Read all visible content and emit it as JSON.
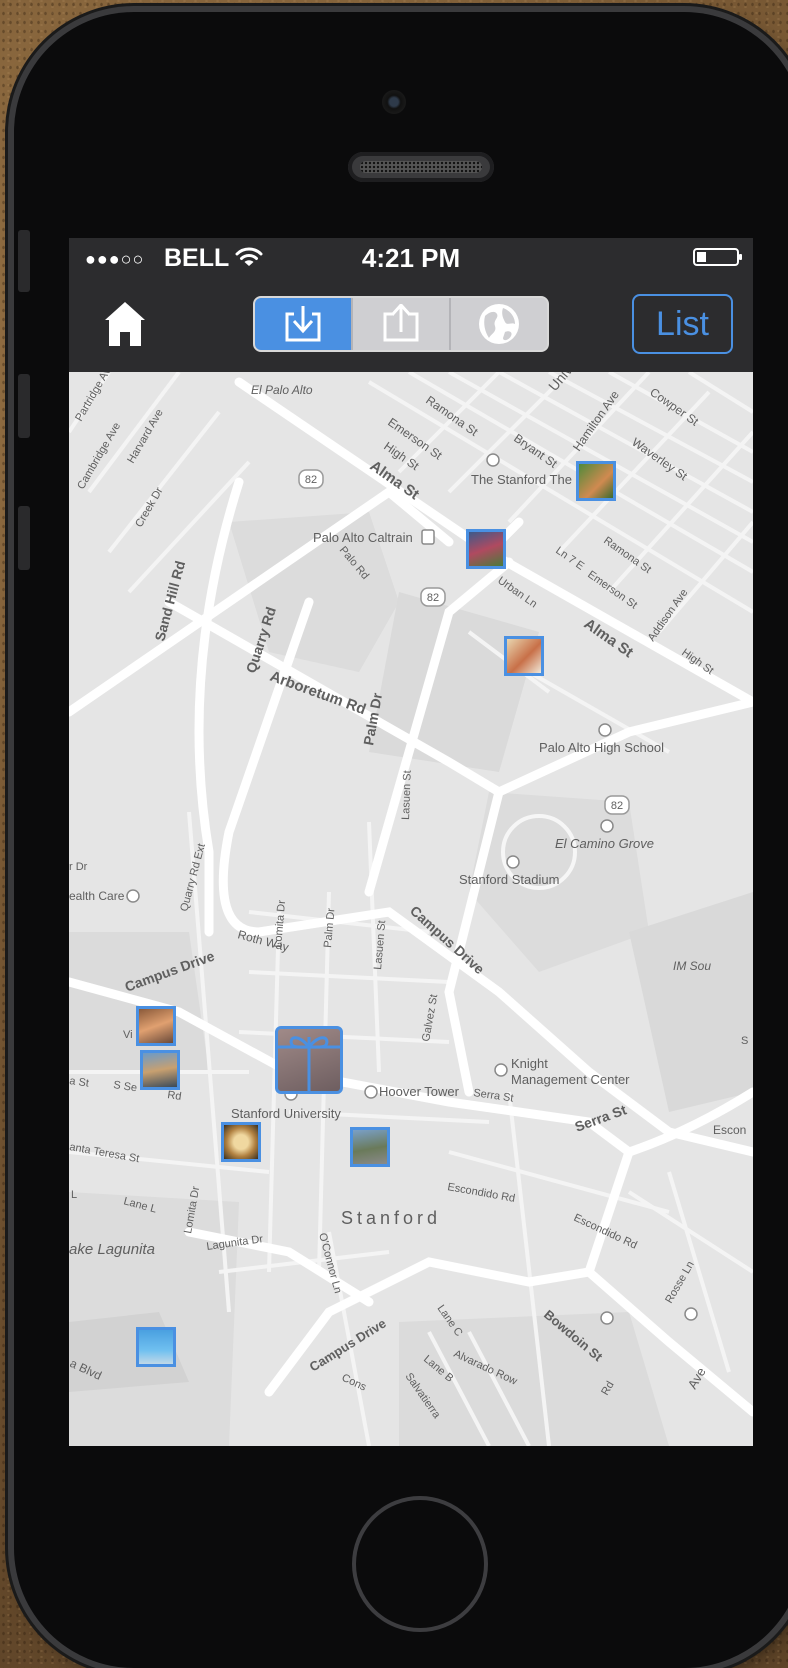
{
  "status_bar": {
    "signal": "●●●○○",
    "carrier": "BELL",
    "time": "4:21 PM"
  },
  "nav": {
    "segments": [
      "download-icon",
      "upload-icon",
      "globe-icon"
    ],
    "active_segment": 0,
    "list_label": "List"
  },
  "colors": {
    "accent": "#4a90e2",
    "bar": "#2c2c2e",
    "map_bg": "#e6e6e6"
  },
  "map": {
    "labels": {
      "el_palo_alto": "El Palo Alto",
      "emerson_st": "Emerson St",
      "ramona_st": "Ramona St",
      "high_st": "High St",
      "bryant_st": "Bryant St",
      "hamilton_ave": "Hamilton Ave",
      "waverley_st": "Waverley St",
      "cowper_st": "Cowper St",
      "univ": "Univ",
      "partridge_ave": "Partridge Ave",
      "cambridge_ave": "Cambridge Ave",
      "harvard_ave": "Harvard Ave",
      "creek_dr": "Creek Dr",
      "route_82": "82",
      "alma_st": "Alma St",
      "stanford_theatre": "The Stanford The",
      "palo_alto_caltrain": "Palo Alto Caltrain",
      "sand_hill_rd": "Sand Hill Rd",
      "palo_rd": "Palo Rd",
      "urban_ln": "Urban Ln",
      "ln_7_e": "Ln 7 E",
      "emerson_st_2": "Emerson St",
      "ramona_st_2": "Ramona St",
      "addison_ave": "Addison Ave",
      "alma_st_2": "Alma St",
      "high_st_2": "High St",
      "quarry_rd": "Quarry Rd",
      "arboretum_rd": "Arboretum Rd",
      "palm_dr": "Palm Dr",
      "palo_alto_high_school": "Palo Alto High School",
      "lasuen_st": "Lasuen St",
      "el_camino_grove": "El Camino Grove",
      "quarry_rd_ext": "Quarry Rd Ext",
      "stanford_stadium": "Stanford Stadium",
      "health_care": "ealth Care",
      "lomita_dr": "Lomita Dr",
      "palm_dr_2": "Palm Dr",
      "lasuen_st_2": "Lasuen St",
      "campus_drive_e": "Campus Drive",
      "roth_way": "Roth Way",
      "im_sou": "IM Sou",
      "campus_drive_w": "Campus Drive",
      "galvez_st": "Galvez St",
      "knight_1": "Knight",
      "knight_2": "Management Center",
      "via": "Vi",
      "s_se_rd": "S Se",
      "rd_suffix": "Rd",
      "sa_st": "a St",
      "hoover_tower": "Hoover Tower",
      "serra_st": "Serra St",
      "serra_st_2": "Serra St",
      "escon": "Escon",
      "stanford_university": "Stanford University",
      "santa_teresa_st": "anta Teresa St",
      "escondido_rd": "Escondido Rd",
      "escondido_rd_2": "Escondido Rd",
      "stanford": "Stanford",
      "lane_l": "Lane L",
      "l_left": "L",
      "lomita_dr_2": "Lomita Dr",
      "lagunita_dr": "Lagunita Dr",
      "oconnor_ln": "O'Connor Ln",
      "lake_lagunita": "ake Lagunita",
      "rosse_ln": "Rosse Ln",
      "campus_drive_s": "Campus Drive",
      "lane_c": "Lane C",
      "bowdoin_st": "Bowdoin St",
      "a_blvd": "a Blvd",
      "lane_b": "Lane B",
      "alvarado_row": "Alvarado Row",
      "salvatierra": "Salvatierra",
      "const": "Cons",
      "ave": "Ave",
      "rd_end": "Rd",
      "r_dr": "r Dr",
      "s_right": "S"
    },
    "pins": [
      "photo-pin-theatre",
      "photo-pin-children",
      "photo-pin-food",
      "photo-pin-woman",
      "photo-pin-couple",
      "photo-pin-dumplings",
      "photo-pin-fountain",
      "photo-pin-beach"
    ],
    "gift": "gift-icon"
  }
}
